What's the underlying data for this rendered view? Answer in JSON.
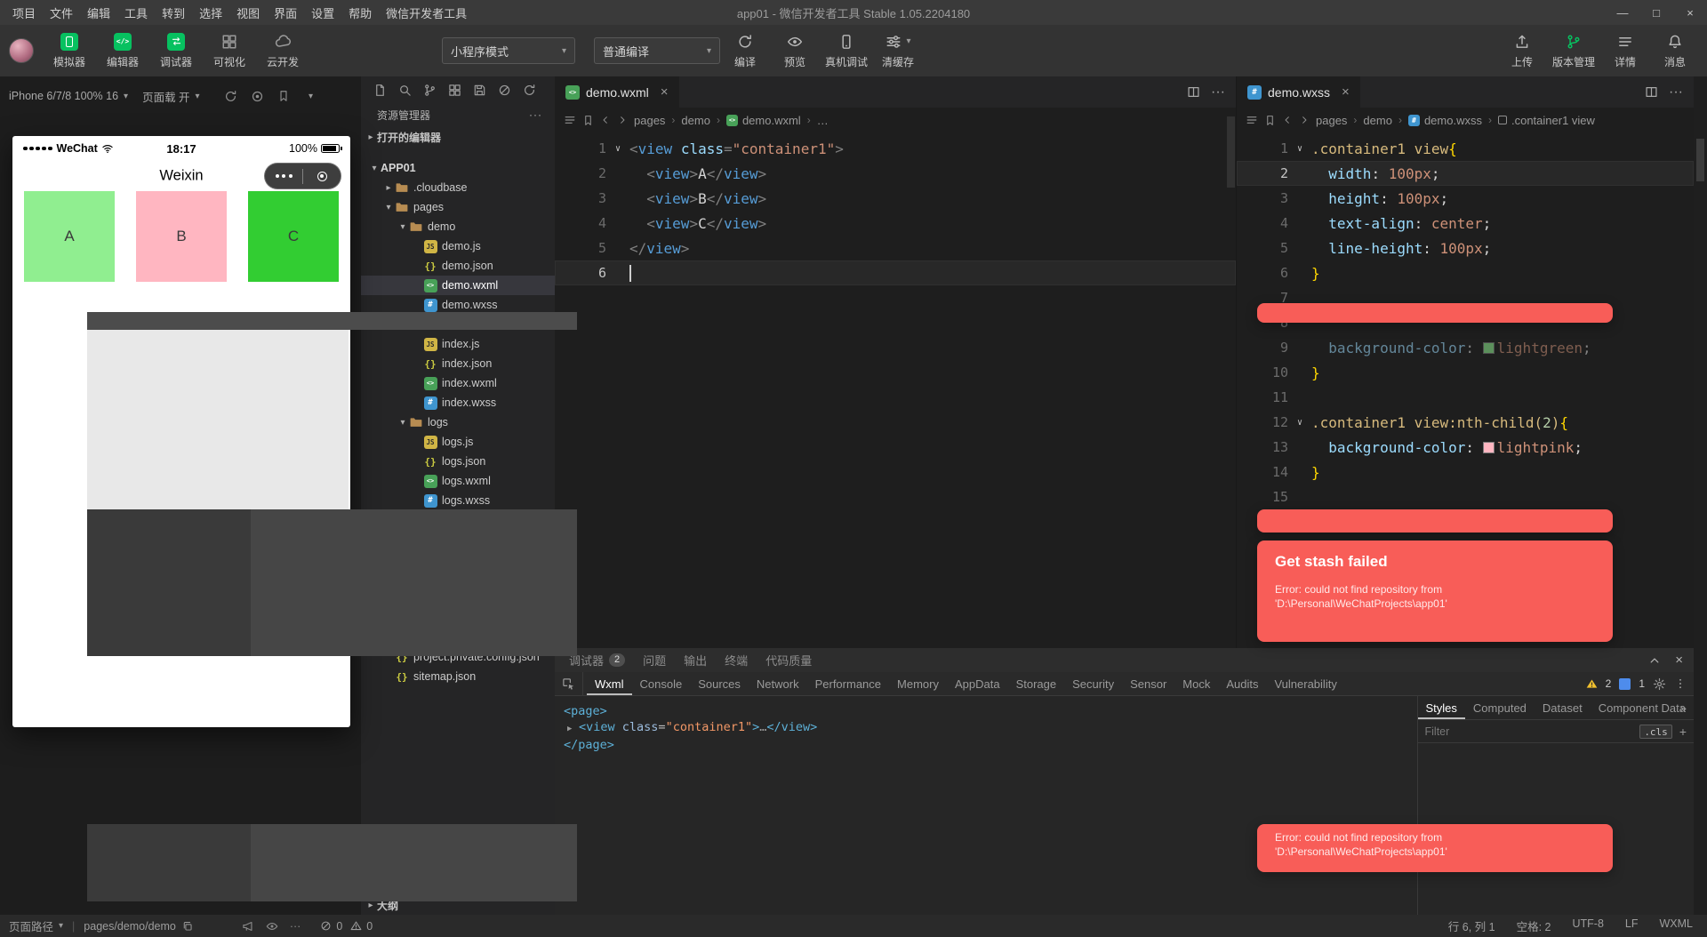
{
  "window": {
    "menus": [
      "项目",
      "文件",
      "编辑",
      "工具",
      "转到",
      "选择",
      "视图",
      "界面",
      "设置",
      "帮助",
      "微信开发者工具"
    ],
    "title": "app01 - 微信开发者工具 Stable 1.05.2204180",
    "controls": {
      "minimize": "—",
      "maximize": "□",
      "close": "×"
    }
  },
  "toolbar": {
    "main_buttons": [
      {
        "label": "模拟器",
        "icon": "simulator-icon"
      },
      {
        "label": "编辑器",
        "icon": "editor-icon"
      },
      {
        "label": "调试器",
        "icon": "debugger-icon"
      },
      {
        "label": "可视化",
        "icon": "visual-icon"
      },
      {
        "label": "云开发",
        "icon": "cloud-icon"
      }
    ],
    "mode_select": {
      "value": "小程序模式"
    },
    "compile_select": {
      "value": "普通编译"
    },
    "action_buttons": [
      {
        "label": "编译",
        "icon": "compile-refresh-icon"
      },
      {
        "label": "预览",
        "icon": "preview-eye-icon"
      },
      {
        "label": "真机调试",
        "icon": "real-device-icon"
      },
      {
        "label": "清缓存",
        "icon": "clear-cache-icon",
        "caret": true
      }
    ],
    "right_buttons": [
      {
        "label": "上传",
        "icon": "upload-icon"
      },
      {
        "label": "版本管理",
        "icon": "version-branch-icon",
        "accent": "#07c160"
      },
      {
        "label": "详情",
        "icon": "details-icon"
      },
      {
        "label": "消息",
        "icon": "message-icon"
      }
    ],
    "accent_green": "#07c160"
  },
  "simulator": {
    "device": "iPhone 6/7/8 100% 16",
    "reload_toggle": "页面载 开",
    "phone": {
      "carrier": "WeChat",
      "time": "18:17",
      "battery": "100%",
      "nav_title": "Weixin",
      "boxes": [
        {
          "label": "A",
          "color": "#90ee90"
        },
        {
          "label": "B",
          "color": "#ffb6c1"
        },
        {
          "label": "C",
          "color": "#32cd32"
        }
      ]
    }
  },
  "explorer": {
    "title": "资源管理器",
    "open_editors_label": "打开的编辑器",
    "outline_label": "大纲",
    "tree": [
      {
        "label": "APP01",
        "level": 0,
        "kind": "root",
        "expanded": true
      },
      {
        "label": ".cloudbase",
        "level": 1,
        "kind": "folder",
        "expanded": false
      },
      {
        "label": "pages",
        "level": 1,
        "kind": "folder",
        "expanded": true
      },
      {
        "label": "demo",
        "level": 2,
        "kind": "folder",
        "expanded": true
      },
      {
        "label": "demo.js",
        "level": 3,
        "kind": "js"
      },
      {
        "label": "demo.json",
        "level": 3,
        "kind": "json"
      },
      {
        "label": "demo.wxml",
        "level": 3,
        "kind": "wxml",
        "selected": true
      },
      {
        "label": "demo.wxss",
        "level": 3,
        "kind": "wxss"
      },
      {
        "spacer": true
      },
      {
        "label": "index.js",
        "level": 3,
        "kind": "js"
      },
      {
        "label": "index.json",
        "level": 3,
        "kind": "json"
      },
      {
        "label": "index.wxml",
        "level": 3,
        "kind": "wxml"
      },
      {
        "label": "index.wxss",
        "level": 3,
        "kind": "wxss"
      },
      {
        "label": "logs",
        "level": 2,
        "kind": "folder",
        "expanded": true
      },
      {
        "label": "logs.js",
        "level": 3,
        "kind": "js"
      },
      {
        "label": "logs.json",
        "level": 3,
        "kind": "json"
      },
      {
        "label": "logs.wxml",
        "level": 3,
        "kind": "wxml"
      },
      {
        "label": "logs.wxss",
        "level": 3,
        "kind": "wxss"
      },
      {
        "spacer": true,
        "tall": true
      },
      {
        "label": "project.private.config.json",
        "level": 1,
        "kind": "json"
      },
      {
        "label": "sitemap.json",
        "level": 1,
        "kind": "json"
      }
    ]
  },
  "wxml_editor": {
    "tab": "demo.wxml",
    "breadcrumb": [
      "pages",
      "demo",
      "demo.wxml",
      "…"
    ],
    "lines": [
      {
        "n": 1,
        "fold": true,
        "t": [
          [
            "p",
            "<"
          ],
          [
            "tag",
            "view"
          ],
          [
            "x",
            " "
          ],
          [
            "attr",
            "class"
          ],
          [
            "p",
            "="
          ],
          [
            "str",
            "\"container1\""
          ],
          [
            "p",
            ">"
          ]
        ]
      },
      {
        "n": 2,
        "t": [
          [
            "x",
            "  "
          ],
          [
            "p",
            "<"
          ],
          [
            "tag",
            "view"
          ],
          [
            "p",
            ">"
          ],
          [
            "x",
            "A"
          ],
          [
            "p",
            "</"
          ],
          [
            "tag",
            "view"
          ],
          [
            "p",
            ">"
          ]
        ]
      },
      {
        "n": 3,
        "t": [
          [
            "x",
            "  "
          ],
          [
            "p",
            "<"
          ],
          [
            "tag",
            "view"
          ],
          [
            "p",
            ">"
          ],
          [
            "x",
            "B"
          ],
          [
            "p",
            "</"
          ],
          [
            "tag",
            "view"
          ],
          [
            "p",
            ">"
          ]
        ]
      },
      {
        "n": 4,
        "t": [
          [
            "x",
            "  "
          ],
          [
            "p",
            "<"
          ],
          [
            "tag",
            "view"
          ],
          [
            "p",
            ">"
          ],
          [
            "x",
            "C"
          ],
          [
            "p",
            "</"
          ],
          [
            "tag",
            "view"
          ],
          [
            "p",
            ">"
          ]
        ]
      },
      {
        "n": 5,
        "t": [
          [
            "p",
            "</"
          ],
          [
            "tag",
            "view"
          ],
          [
            "p",
            ">"
          ]
        ]
      },
      {
        "n": 6,
        "current": true,
        "caret": true,
        "t": []
      }
    ]
  },
  "wxss_editor": {
    "tab": "demo.wxss",
    "breadcrumb": [
      "pages",
      "demo",
      "demo.wxss",
      ".container1 view"
    ],
    "lines": [
      {
        "n": 1,
        "fold": true,
        "t": [
          [
            "sel",
            ".container1 view"
          ],
          [
            "brace",
            "{"
          ]
        ]
      },
      {
        "n": 2,
        "current": true,
        "t": [
          [
            "x",
            "  "
          ],
          [
            "prop",
            "width"
          ],
          [
            "x",
            ": "
          ],
          [
            "val",
            "100px"
          ],
          [
            "x",
            ";"
          ]
        ]
      },
      {
        "n": 3,
        "t": [
          [
            "x",
            "  "
          ],
          [
            "prop",
            "height"
          ],
          [
            "x",
            ": "
          ],
          [
            "val",
            "100px"
          ],
          [
            "x",
            ";"
          ]
        ]
      },
      {
        "n": 4,
        "t": [
          [
            "x",
            "  "
          ],
          [
            "prop",
            "text-align"
          ],
          [
            "x",
            ": "
          ],
          [
            "val",
            "center"
          ],
          [
            "x",
            ";"
          ]
        ]
      },
      {
        "n": 5,
        "t": [
          [
            "x",
            "  "
          ],
          [
            "prop",
            "line-height"
          ],
          [
            "x",
            ": "
          ],
          [
            "val",
            "100px"
          ],
          [
            "x",
            ";"
          ]
        ]
      },
      {
        "n": 6,
        "t": [
          [
            "brace",
            "}"
          ]
        ]
      },
      {
        "n": 7,
        "t": []
      },
      {
        "n": 8,
        "t": []
      },
      {
        "n": 9,
        "dim": true,
        "t": [
          [
            "x",
            "  "
          ],
          [
            "prop",
            "background-color"
          ],
          [
            "x",
            ": "
          ],
          [
            "swatch",
            "#90ee90"
          ],
          [
            "val",
            "lightgreen"
          ],
          [
            "x",
            ";"
          ]
        ]
      },
      {
        "n": 10,
        "t": [
          [
            "brace",
            "}"
          ]
        ]
      },
      {
        "n": 11,
        "t": []
      },
      {
        "n": 12,
        "fold": true,
        "t": [
          [
            "sel",
            ".container1 view:nth-child("
          ],
          [
            "num",
            "2"
          ],
          [
            "sel",
            ")"
          ],
          [
            "brace",
            "{"
          ]
        ]
      },
      {
        "n": 13,
        "t": [
          [
            "x",
            "  "
          ],
          [
            "prop",
            "background-color"
          ],
          [
            "x",
            ": "
          ],
          [
            "swatch",
            "#ffb6c1"
          ],
          [
            "val",
            "lightpink"
          ],
          [
            "x",
            ";"
          ]
        ]
      },
      {
        "n": 14,
        "t": [
          [
            "brace",
            "}"
          ]
        ]
      },
      {
        "n": 15,
        "t": []
      }
    ]
  },
  "debugger": {
    "panel_tabs": [
      {
        "label": "调试器",
        "badge": "2"
      },
      {
        "label": "问题"
      },
      {
        "label": "输出"
      },
      {
        "label": "终端"
      },
      {
        "label": "代码质量"
      }
    ],
    "devtools_tabs": [
      "Wxml",
      "Console",
      "Sources",
      "Network",
      "Performance",
      "Memory",
      "AppData",
      "Storage",
      "Security",
      "Sensor",
      "Mock",
      "Audits",
      "Vulnerability"
    ],
    "active_devtools_tab": "Wxml",
    "warning_count": "2",
    "info_count": "1",
    "wxml_tree": [
      {
        "indent": 0,
        "t": [
          [
            "tag",
            "<page>"
          ]
        ]
      },
      {
        "indent": 1,
        "arrow": true,
        "t": [
          [
            "tag",
            "<view"
          ],
          [
            "x",
            " "
          ],
          [
            "attr",
            "class"
          ],
          [
            "x",
            "="
          ],
          [
            "val",
            "\"container1\""
          ],
          [
            "tag",
            ">"
          ],
          [
            "dim",
            "…"
          ],
          [
            "tag",
            "</view>"
          ]
        ]
      },
      {
        "indent": 0,
        "t": [
          [
            "tag",
            "</page>"
          ]
        ]
      }
    ],
    "styles_tabs": [
      "Styles",
      "Computed",
      "Dataset",
      "Component Data"
    ],
    "active_styles_tab": "Styles",
    "overflow_chevron": "»",
    "filter_placeholder": "Filter",
    "cls_label": ".cls",
    "add_label": "+"
  },
  "toast": {
    "title": "Get stash failed",
    "line1": "Error: could not find repository from",
    "line2": "'D:\\Personal\\WeChatProjects\\app01'"
  },
  "statusbar": {
    "path_label": "页面路径",
    "page_path": "pages/demo/demo",
    "error_count": "0",
    "warning_count": "0",
    "cursor_position": "行 6, 列 1",
    "indent": "空格: 2",
    "encoding": "UTF-8",
    "eol": "LF",
    "language": "WXML"
  }
}
